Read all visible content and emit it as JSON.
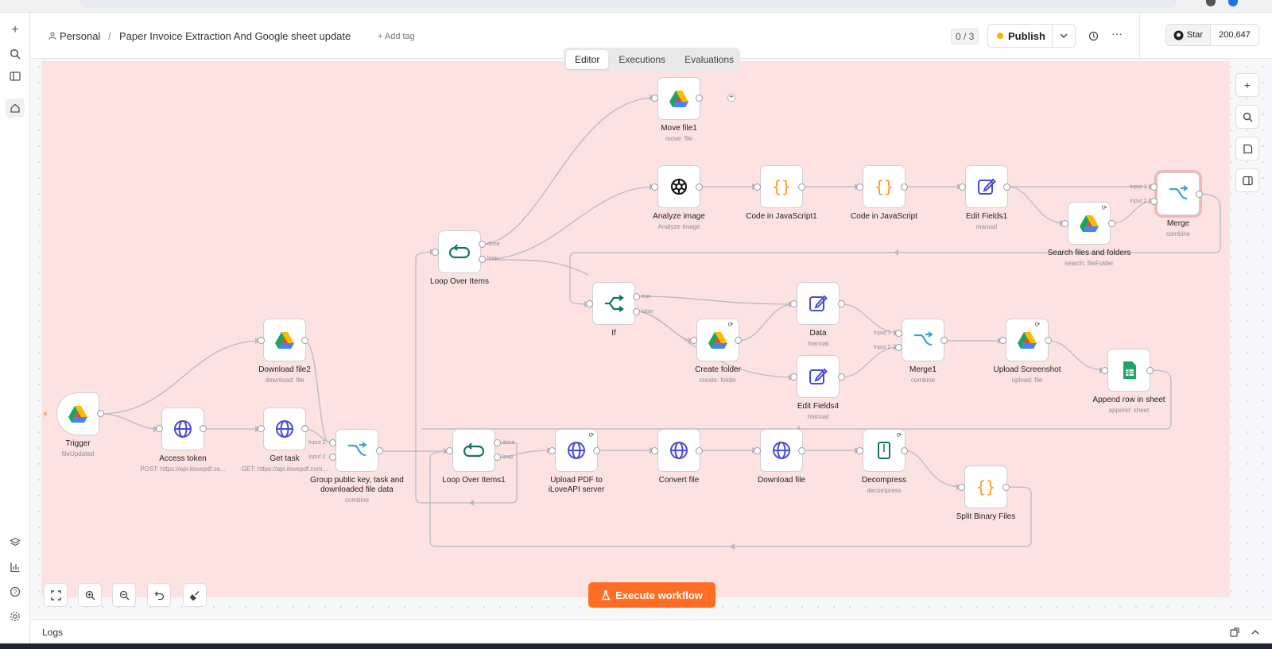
{
  "header": {
    "project": "Personal",
    "title": "Paper Invoice Extraction And Google sheet update",
    "add_tag": "+ Add tag",
    "counter": "0 / 3",
    "publish": "Publish",
    "github_star": "Star",
    "github_count": "200,647"
  },
  "tabs": [
    "Editor",
    "Executions",
    "Evaluations"
  ],
  "nodes": {
    "move_file1": {
      "label": "Move file1",
      "sub": "move: file"
    },
    "analyze_image": {
      "label": "Analyze image",
      "sub": "Analyze Image"
    },
    "code_js1": {
      "label": "Code in JavaScript1",
      "sub": ""
    },
    "code_js": {
      "label": "Code in JavaScript",
      "sub": ""
    },
    "edit_fields1": {
      "label": "Edit Fields1",
      "sub": "manual"
    },
    "merge": {
      "label": "Merge",
      "sub": "combine"
    },
    "search_files": {
      "label": "Search files and folders",
      "sub": "search: fileFolder"
    },
    "loop_over_items": {
      "label": "Loop Over Items",
      "sub": ""
    },
    "if": {
      "label": "If",
      "sub": ""
    },
    "data": {
      "label": "Data",
      "sub": "manual"
    },
    "create_folder": {
      "label": "Create folder",
      "sub": "create: folder"
    },
    "merge1": {
      "label": "Merge1",
      "sub": "combine"
    },
    "upload_screenshot": {
      "label": "Upload Screenshot",
      "sub": "upload: file"
    },
    "append_row": {
      "label": "Append row in sheet",
      "sub": "append: sheet"
    },
    "edit_fields4": {
      "label": "Edit Fields4",
      "sub": "manual"
    },
    "download_file2": {
      "label": "Download file2",
      "sub": "download: file"
    },
    "trigger": {
      "label": "Trigger",
      "sub": "fileUpdated"
    },
    "access_token": {
      "label": "Access token",
      "sub": "POST: https://api.ilovepdf.co..."
    },
    "get_task": {
      "label": "Get task",
      "sub": "GET: https://api.ilovepdf.com..."
    },
    "group_merge": {
      "label": "Group public key, task and downloaded file data",
      "sub": "combine"
    },
    "loop_over_items1": {
      "label": "Loop Over Items1",
      "sub": ""
    },
    "upload_pdf": {
      "label": "Upload PDF to iLoveAPI server",
      "sub": ""
    },
    "convert_file": {
      "label": "Convert file",
      "sub": ""
    },
    "download_file": {
      "label": "Download file",
      "sub": ""
    },
    "decompress": {
      "label": "Decompress",
      "sub": "decompress"
    },
    "split_binary": {
      "label": "Split Binary Files",
      "sub": ""
    }
  },
  "port_labels": {
    "done": "done",
    "loop": "loop",
    "true": "true",
    "false": "false",
    "input1": "Input 1",
    "input2": "Input 2"
  },
  "execute_button": "Execute workflow",
  "logs_label": "Logs",
  "colors": {
    "accent": "#ff6d24",
    "canvas_highlight": "#fde2e2"
  }
}
